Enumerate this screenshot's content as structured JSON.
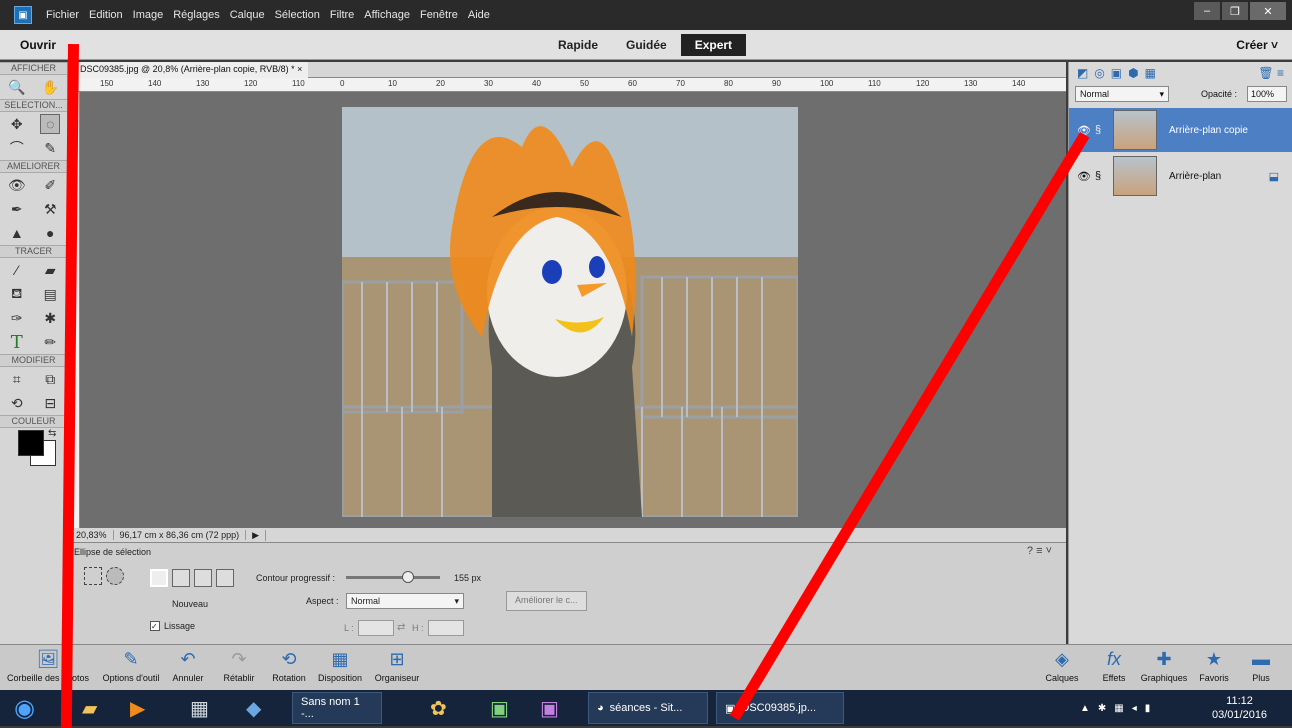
{
  "menubar": {
    "items": [
      "Fichier",
      "Edition",
      "Image",
      "Réglages",
      "Calque",
      "Sélection",
      "Filtre",
      "Affichage",
      "Fenêtre",
      "Aide"
    ]
  },
  "modebar": {
    "open_label": "Ouvrir",
    "create_label": "Créer",
    "modes": [
      "Rapide",
      "Guidée",
      "Expert"
    ]
  },
  "toolbox": {
    "sections": [
      "AFFICHER",
      "SELECTION...",
      "AMELIORER",
      "TRACER",
      "MODIFIER",
      "COULEUR"
    ]
  },
  "document": {
    "tab_title": "DSC09385.jpg @ 20,8% (Arrière-plan copie, RVB/8) *",
    "ruler_labels": [
      "150",
      "140",
      "130",
      "120",
      "110",
      "0",
      "10",
      "20",
      "30",
      "40",
      "50",
      "60",
      "70",
      "80",
      "90",
      "100",
      "110",
      "120",
      "130",
      "140"
    ],
    "zoom": "20,83%",
    "size_info": "96,17 cm x 86,36 cm (72 ppp)"
  },
  "options": {
    "tool_name": "Ellipse de sélection",
    "new_label": "Nouveau",
    "smoothing_label": "Lissage",
    "feather_label": "Contour progressif :",
    "feather_value": "155 px",
    "aspect_label": "Aspect :",
    "aspect_value": "Normal",
    "l_label": "L :",
    "h_label": "H :",
    "refine_button": "Améliorer le c..."
  },
  "layers": {
    "blend_mode": "Normal",
    "opacity_label": "Opacité :",
    "opacity_value": "100%",
    "items": [
      {
        "name": "Arrière-plan copie",
        "selected": true
      },
      {
        "name": "Arrière-plan",
        "selected": false
      }
    ]
  },
  "bottombar": {
    "left_items": [
      "Corbeille des photos",
      "Options d'outil",
      "Annuler",
      "Rétablir",
      "Rotation",
      "Disposition",
      "Organiseur"
    ],
    "right_items": [
      "Calques",
      "Effets",
      "Graphiques",
      "Favoris",
      "Plus"
    ]
  },
  "taskbar": {
    "items": [
      "Sans nom 1 -...",
      "séances - Sit...",
      "DSC09385.jp..."
    ],
    "time": "11:12",
    "date": "03/01/2016"
  },
  "colors": {
    "selected_layer": "#4c7fc4",
    "annotation_red": "#ff0000"
  }
}
